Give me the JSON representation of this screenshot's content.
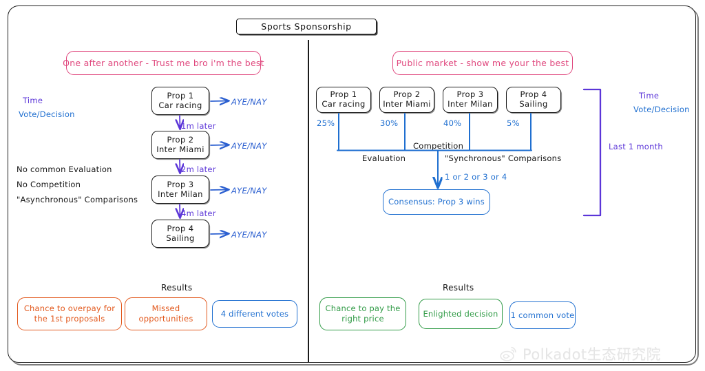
{
  "title": "Sports Sponsorship",
  "left_panel": {
    "header": "One after another - Trust me bro i'm the best",
    "axis_labels": {
      "time": "Time",
      "vote": "Vote/Decision"
    },
    "notes": [
      "No common Evaluation",
      "No Competition",
      "\"Asynchronous\" Comparisons"
    ],
    "proposals": [
      {
        "name": "Prop 1",
        "subject": "Car racing",
        "vote": "AYE/NAY"
      },
      {
        "name": "Prop 2",
        "subject": "Inter Miami",
        "vote": "AYE/NAY"
      },
      {
        "name": "Prop 3",
        "subject": "Inter Milan",
        "vote": "AYE/NAY"
      },
      {
        "name": "Prop 4",
        "subject": "Sailing",
        "vote": "AYE/NAY"
      }
    ],
    "delays": [
      "1m later",
      "2m later",
      "4m later"
    ],
    "results_label": "Results",
    "results": [
      {
        "text_line1": "Chance to overpay for",
        "text_line2": "the 1st proposals",
        "color": "#e2571b"
      },
      {
        "text_line1": "Missed",
        "text_line2": "opportunities",
        "color": "#e2571b"
      },
      {
        "text_line1": "4 different votes",
        "text_line2": "",
        "color": "#1f6fd0"
      }
    ]
  },
  "right_panel": {
    "header": "Public market - show me your the best",
    "axis_labels": {
      "time": "Time",
      "vote": "Vote/Decision"
    },
    "bracket_label": "Last 1 month",
    "proposals": [
      {
        "name": "Prop 1",
        "subject": "Car racing",
        "percent": "25%"
      },
      {
        "name": "Prop 2",
        "subject": "Inter Miami",
        "percent": "30%"
      },
      {
        "name": "Prop 3",
        "subject": "Inter Milan",
        "percent": "40%"
      },
      {
        "name": "Prop 4",
        "subject": "Sailing",
        "percent": "5%"
      }
    ],
    "competition_label": "Competition",
    "evaluation_label": "Evaluation",
    "sync_label": "\"Synchronous\" Comparisons",
    "choice_label": "1 or 2 or 3 or 4",
    "consensus": "Consensus: Prop 3 wins",
    "results_label": "Results",
    "results": [
      {
        "text_line1": "Chance to pay the",
        "text_line2": "right price",
        "color": "#2f9a45"
      },
      {
        "text_line1": "Enlighted decision",
        "text_line2": "",
        "color": "#2f9a45"
      },
      {
        "text_line1": "1 common vote",
        "text_line2": "",
        "color": "#1f6fd0"
      }
    ]
  },
  "watermark": {
    "text": "Polkadot生态研究院",
    "icon": "weibo-icon"
  },
  "colors": {
    "pink": "#e0487e",
    "blue": "#1f6fd0",
    "purple": "#5b35d8",
    "orange": "#e2571b",
    "green": "#2f9a45",
    "ink": "#141414"
  }
}
